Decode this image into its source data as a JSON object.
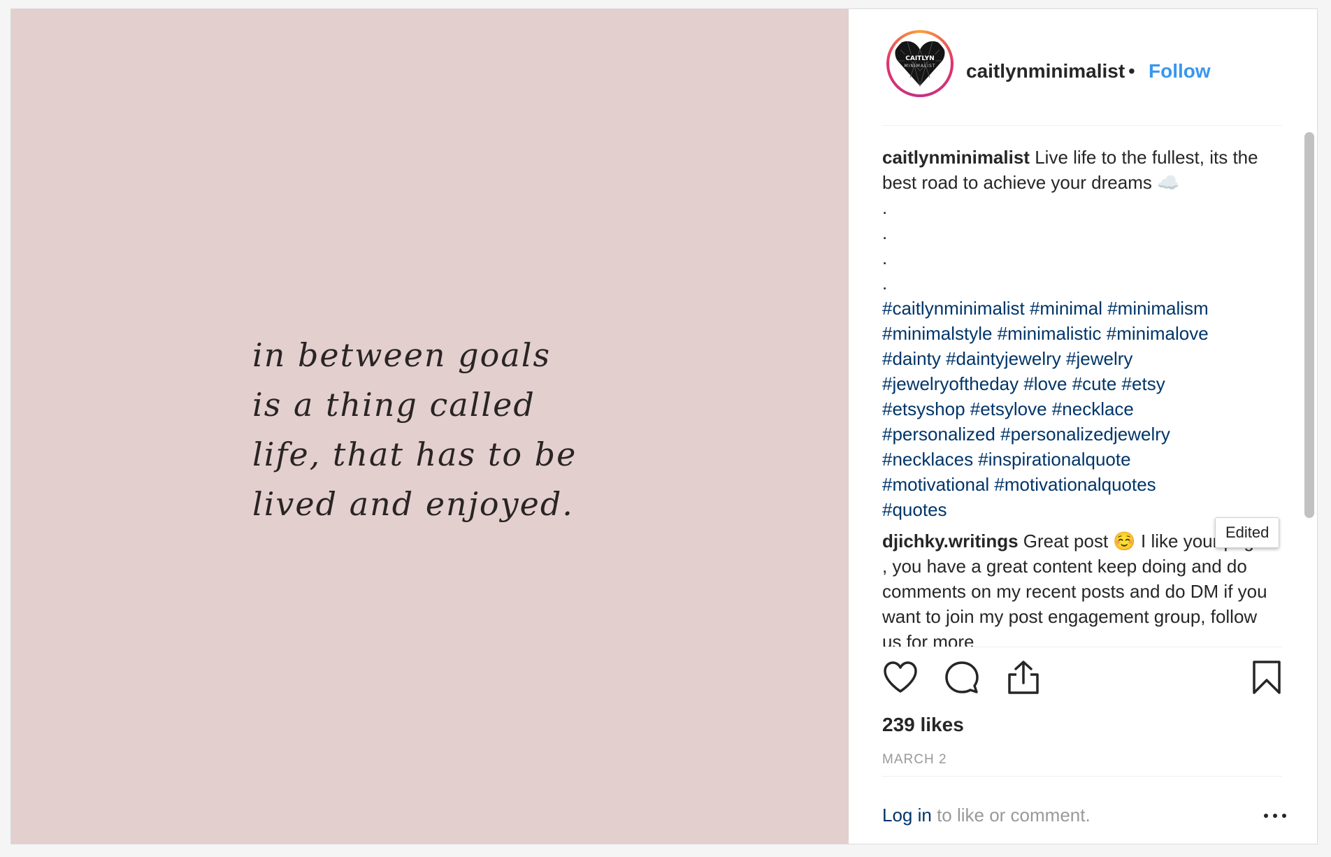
{
  "post": {
    "image": {
      "quote_lines": [
        "in between goals",
        "is a thing called",
        "life, that has to be",
        "lived and enjoyed."
      ],
      "background_color": "#e2cfce"
    },
    "header": {
      "avatar_text_top": "CAITLYN",
      "avatar_text_bottom": "MINIMALIST",
      "username": "caitlynminimalist",
      "separator": "•",
      "follow_label": "Follow"
    },
    "caption": {
      "username": "caitlynminimalist",
      "text": "Live life to the fullest, its the best road to achieve your dreams ☁️",
      "dots": [
        ".",
        ".",
        ".",
        "."
      ],
      "hashtags": [
        "#caitlynminimalist #minimal #minimalism",
        "#minimalstyle #minimalistic #minimalove",
        "#dainty #daintyjewelry #jewelry",
        "#jewelryoftheday #love #cute #etsy",
        "#etsyshop #etsylove #necklace",
        "#personalized #personalizedjewelry",
        "#necklaces #inspirationalquote",
        "#motivational #motivationalquotes",
        "#quotes"
      ]
    },
    "tooltip": "Edited",
    "comment": {
      "username": "djichky.writings",
      "text": "Great post ☺️ I like your page , you have a great content keep doing and do comments on my recent posts and do DM if you want to join my post engagement group, follow us for more"
    },
    "actions": {
      "like_icon": "heart-icon",
      "comment_icon": "comment-bubble-icon",
      "share_icon": "share-icon",
      "save_icon": "bookmark-icon"
    },
    "likes": "239 likes",
    "date": "MARCH 2",
    "login": {
      "link": "Log in",
      "text": " to like or comment."
    },
    "colors": {
      "link": "#003569",
      "follow": "#3897f0",
      "muted": "#999999"
    }
  }
}
